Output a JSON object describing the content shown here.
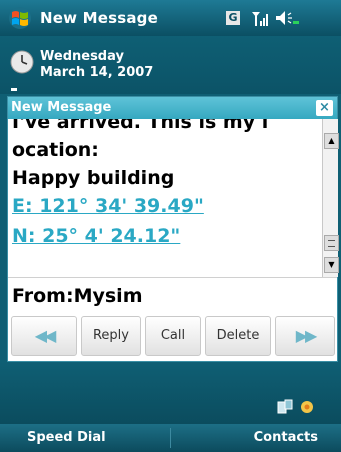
{
  "status_bar": {
    "title": "New Message",
    "network_type": "G"
  },
  "today": {
    "day": "Wednesday",
    "date": "March 14, 2007"
  },
  "popup": {
    "title": "New Message",
    "close_label": "×",
    "message_lines": [
      "I've arrived. This is my l",
      "ocation:",
      "Happy building",
      "E: 121° 34' 39.49\"",
      "N: 25° 4' 24.12\""
    ],
    "from": "From:Mysim",
    "buttons": {
      "prev": "◀◀",
      "reply": "Reply",
      "call": "Call",
      "delete": "Delete",
      "next": "▶▶"
    }
  },
  "softkeys": {
    "left": "Speed Dial",
    "right": "Contacts"
  },
  "icons": {
    "start": "windows-start-icon",
    "signal": "signal-strength-icon",
    "volume": "volume-icon",
    "clock": "clock-icon",
    "close": "close-icon",
    "tray1": "connectivity-icon",
    "tray2": "notification-icon"
  },
  "colors": {
    "background": "#0f5f74",
    "popup_header": "#35a8c0",
    "link": "#2aa8c4"
  }
}
